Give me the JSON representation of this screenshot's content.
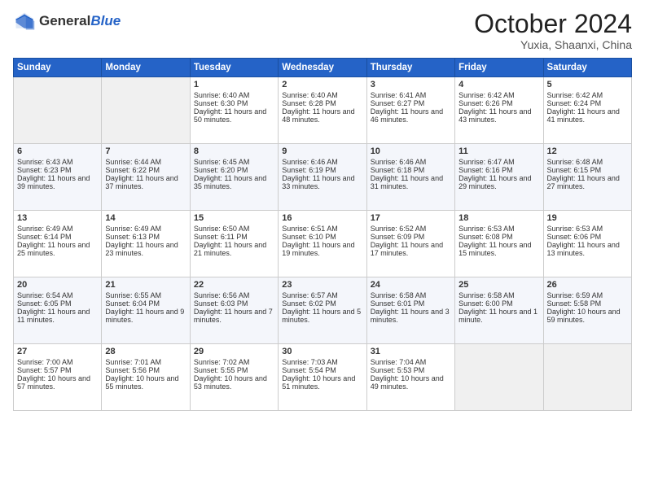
{
  "header": {
    "logo_general": "General",
    "logo_blue": "Blue",
    "month_title": "October 2024",
    "location": "Yuxia, Shaanxi, China"
  },
  "days_of_week": [
    "Sunday",
    "Monday",
    "Tuesday",
    "Wednesday",
    "Thursday",
    "Friday",
    "Saturday"
  ],
  "weeks": [
    [
      {
        "day": "",
        "empty": true
      },
      {
        "day": "",
        "empty": true
      },
      {
        "day": "1",
        "sunrise": "Sunrise: 6:40 AM",
        "sunset": "Sunset: 6:30 PM",
        "daylight": "Daylight: 11 hours and 50 minutes."
      },
      {
        "day": "2",
        "sunrise": "Sunrise: 6:40 AM",
        "sunset": "Sunset: 6:28 PM",
        "daylight": "Daylight: 11 hours and 48 minutes."
      },
      {
        "day": "3",
        "sunrise": "Sunrise: 6:41 AM",
        "sunset": "Sunset: 6:27 PM",
        "daylight": "Daylight: 11 hours and 46 minutes."
      },
      {
        "day": "4",
        "sunrise": "Sunrise: 6:42 AM",
        "sunset": "Sunset: 6:26 PM",
        "daylight": "Daylight: 11 hours and 43 minutes."
      },
      {
        "day": "5",
        "sunrise": "Sunrise: 6:42 AM",
        "sunset": "Sunset: 6:24 PM",
        "daylight": "Daylight: 11 hours and 41 minutes."
      }
    ],
    [
      {
        "day": "6",
        "sunrise": "Sunrise: 6:43 AM",
        "sunset": "Sunset: 6:23 PM",
        "daylight": "Daylight: 11 hours and 39 minutes."
      },
      {
        "day": "7",
        "sunrise": "Sunrise: 6:44 AM",
        "sunset": "Sunset: 6:22 PM",
        "daylight": "Daylight: 11 hours and 37 minutes."
      },
      {
        "day": "8",
        "sunrise": "Sunrise: 6:45 AM",
        "sunset": "Sunset: 6:20 PM",
        "daylight": "Daylight: 11 hours and 35 minutes."
      },
      {
        "day": "9",
        "sunrise": "Sunrise: 6:46 AM",
        "sunset": "Sunset: 6:19 PM",
        "daylight": "Daylight: 11 hours and 33 minutes."
      },
      {
        "day": "10",
        "sunrise": "Sunrise: 6:46 AM",
        "sunset": "Sunset: 6:18 PM",
        "daylight": "Daylight: 11 hours and 31 minutes."
      },
      {
        "day": "11",
        "sunrise": "Sunrise: 6:47 AM",
        "sunset": "Sunset: 6:16 PM",
        "daylight": "Daylight: 11 hours and 29 minutes."
      },
      {
        "day": "12",
        "sunrise": "Sunrise: 6:48 AM",
        "sunset": "Sunset: 6:15 PM",
        "daylight": "Daylight: 11 hours and 27 minutes."
      }
    ],
    [
      {
        "day": "13",
        "sunrise": "Sunrise: 6:49 AM",
        "sunset": "Sunset: 6:14 PM",
        "daylight": "Daylight: 11 hours and 25 minutes."
      },
      {
        "day": "14",
        "sunrise": "Sunrise: 6:49 AM",
        "sunset": "Sunset: 6:13 PM",
        "daylight": "Daylight: 11 hours and 23 minutes."
      },
      {
        "day": "15",
        "sunrise": "Sunrise: 6:50 AM",
        "sunset": "Sunset: 6:11 PM",
        "daylight": "Daylight: 11 hours and 21 minutes."
      },
      {
        "day": "16",
        "sunrise": "Sunrise: 6:51 AM",
        "sunset": "Sunset: 6:10 PM",
        "daylight": "Daylight: 11 hours and 19 minutes."
      },
      {
        "day": "17",
        "sunrise": "Sunrise: 6:52 AM",
        "sunset": "Sunset: 6:09 PM",
        "daylight": "Daylight: 11 hours and 17 minutes."
      },
      {
        "day": "18",
        "sunrise": "Sunrise: 6:53 AM",
        "sunset": "Sunset: 6:08 PM",
        "daylight": "Daylight: 11 hours and 15 minutes."
      },
      {
        "day": "19",
        "sunrise": "Sunrise: 6:53 AM",
        "sunset": "Sunset: 6:06 PM",
        "daylight": "Daylight: 11 hours and 13 minutes."
      }
    ],
    [
      {
        "day": "20",
        "sunrise": "Sunrise: 6:54 AM",
        "sunset": "Sunset: 6:05 PM",
        "daylight": "Daylight: 11 hours and 11 minutes."
      },
      {
        "day": "21",
        "sunrise": "Sunrise: 6:55 AM",
        "sunset": "Sunset: 6:04 PM",
        "daylight": "Daylight: 11 hours and 9 minutes."
      },
      {
        "day": "22",
        "sunrise": "Sunrise: 6:56 AM",
        "sunset": "Sunset: 6:03 PM",
        "daylight": "Daylight: 11 hours and 7 minutes."
      },
      {
        "day": "23",
        "sunrise": "Sunrise: 6:57 AM",
        "sunset": "Sunset: 6:02 PM",
        "daylight": "Daylight: 11 hours and 5 minutes."
      },
      {
        "day": "24",
        "sunrise": "Sunrise: 6:58 AM",
        "sunset": "Sunset: 6:01 PM",
        "daylight": "Daylight: 11 hours and 3 minutes."
      },
      {
        "day": "25",
        "sunrise": "Sunrise: 6:58 AM",
        "sunset": "Sunset: 6:00 PM",
        "daylight": "Daylight: 11 hours and 1 minute."
      },
      {
        "day": "26",
        "sunrise": "Sunrise: 6:59 AM",
        "sunset": "Sunset: 5:58 PM",
        "daylight": "Daylight: 10 hours and 59 minutes."
      }
    ],
    [
      {
        "day": "27",
        "sunrise": "Sunrise: 7:00 AM",
        "sunset": "Sunset: 5:57 PM",
        "daylight": "Daylight: 10 hours and 57 minutes."
      },
      {
        "day": "28",
        "sunrise": "Sunrise: 7:01 AM",
        "sunset": "Sunset: 5:56 PM",
        "daylight": "Daylight: 10 hours and 55 minutes."
      },
      {
        "day": "29",
        "sunrise": "Sunrise: 7:02 AM",
        "sunset": "Sunset: 5:55 PM",
        "daylight": "Daylight: 10 hours and 53 minutes."
      },
      {
        "day": "30",
        "sunrise": "Sunrise: 7:03 AM",
        "sunset": "Sunset: 5:54 PM",
        "daylight": "Daylight: 10 hours and 51 minutes."
      },
      {
        "day": "31",
        "sunrise": "Sunrise: 7:04 AM",
        "sunset": "Sunset: 5:53 PM",
        "daylight": "Daylight: 10 hours and 49 minutes."
      },
      {
        "day": "",
        "empty": true
      },
      {
        "day": "",
        "empty": true
      }
    ]
  ]
}
